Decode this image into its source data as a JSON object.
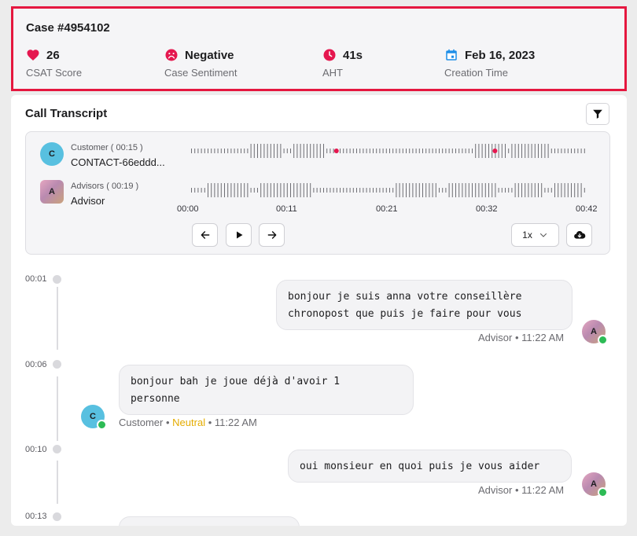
{
  "case": {
    "title": "Case #4954102",
    "stats": [
      {
        "value": "26",
        "label": "CSAT Score",
        "icon": "heart-icon",
        "color": "#e5174f"
      },
      {
        "value": "Negative",
        "label": "Case Sentiment",
        "icon": "sad-face-icon",
        "color": "#e5174f"
      },
      {
        "value": "41s",
        "label": "AHT",
        "icon": "clock-icon",
        "color": "#e5174f"
      },
      {
        "value": "Feb 16, 2023",
        "label": "Creation Time",
        "icon": "calendar-icon",
        "color": "#1d8ee8"
      }
    ]
  },
  "transcript": {
    "title": "Call Transcript",
    "player": {
      "customer": {
        "role": "Customer ( 00:15 )",
        "name": "CONTACT-66eddd...",
        "initial": "C"
      },
      "advisor": {
        "role": "Advisors ( 00:19 )",
        "name": "Advisor",
        "initial": "A"
      },
      "ticks": [
        "00:00",
        "00:11",
        "00:21",
        "00:32",
        "00:42"
      ],
      "speed": "1x"
    },
    "messages": [
      {
        "time": "00:01",
        "text": "bonjour je suis anna votre conseillère\nchronopost que puis je faire pour vous",
        "speaker": "Advisor",
        "timestamp": "11:22 AM",
        "initial": "A"
      },
      {
        "time": "00:06",
        "text": "bonjour bah je joue déjà d'avoir 1\npersonne",
        "speaker": "Customer",
        "sentiment": "Neutral",
        "timestamp": "11:22 AM",
        "initial": "C"
      },
      {
        "time": "00:10",
        "text": "oui monsieur en quoi puis je vous aider",
        "speaker": "Advisor",
        "timestamp": "11:22 AM",
        "initial": "A"
      },
      {
        "time": "00:13"
      }
    ],
    "separator": "•"
  },
  "colors": {
    "accent_red": "#e5173f",
    "online_green": "#2dbb55",
    "neutral": "#e4ac00"
  }
}
